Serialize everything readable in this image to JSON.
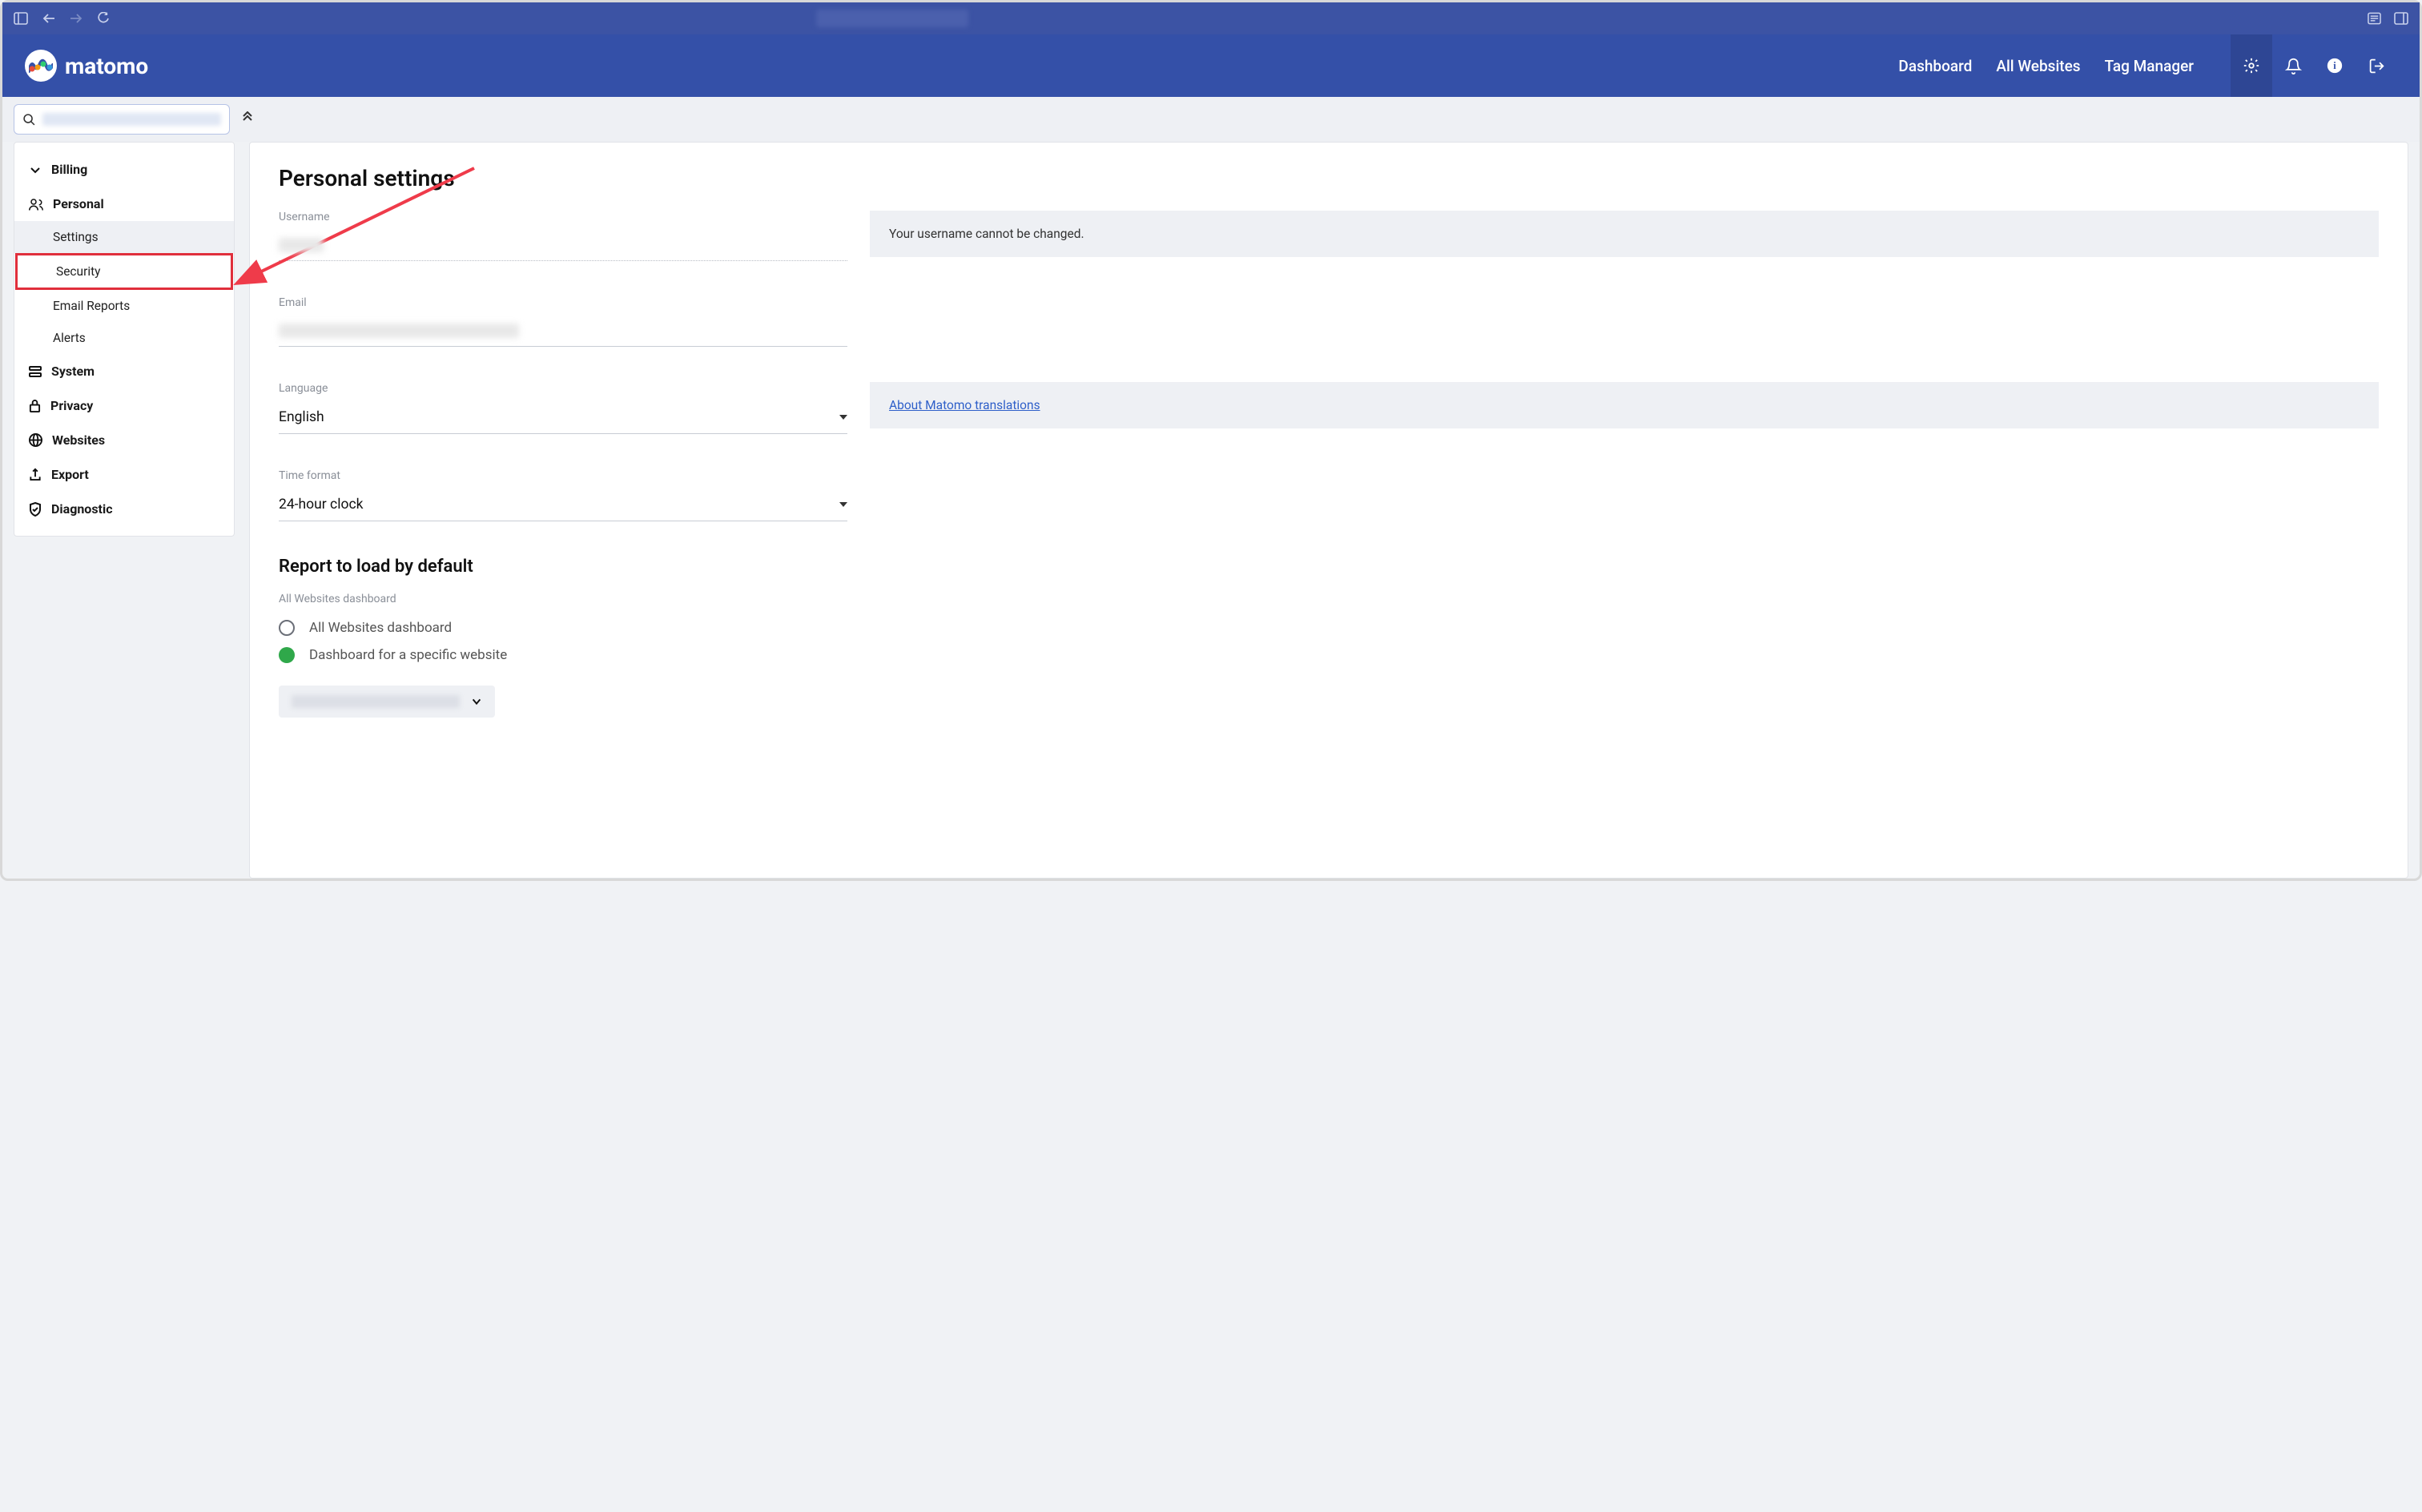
{
  "browser": {},
  "header": {
    "logo_text": "matomo",
    "nav": {
      "dashboard": "Dashboard",
      "all_websites": "All Websites",
      "tag_manager": "Tag Manager"
    }
  },
  "sidebar": {
    "sections": {
      "billing": "Billing",
      "personal": "Personal",
      "system": "System",
      "privacy": "Privacy",
      "websites": "Websites",
      "export": "Export",
      "diagnostic": "Diagnostic"
    },
    "personal_items": {
      "settings": "Settings",
      "security": "Security",
      "email_reports": "Email Reports",
      "alerts": "Alerts"
    }
  },
  "main": {
    "title": "Personal settings",
    "username": {
      "label": "Username",
      "info": "Your username cannot be changed."
    },
    "email": {
      "label": "Email"
    },
    "language": {
      "label": "Language",
      "value": "English",
      "info_link": "About Matomo translations"
    },
    "time_format": {
      "label": "Time format",
      "value": "24-hour clock"
    },
    "report_default": {
      "title": "Report to load by default",
      "subtitle": "All Websites dashboard",
      "option_all": "All Websites dashboard",
      "option_specific": "Dashboard for a specific website"
    }
  }
}
